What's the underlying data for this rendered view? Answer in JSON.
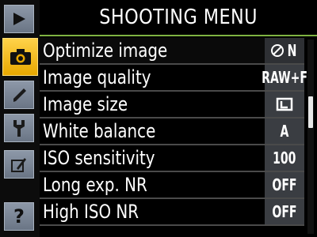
{
  "header": {
    "title": "SHOOTING MENU"
  },
  "tabs": [
    {
      "name": "playback-tab",
      "icon": "play-icon"
    },
    {
      "name": "shooting-tab",
      "icon": "camera-icon",
      "active": true
    },
    {
      "name": "custom-settings-tab",
      "icon": "pencil-icon"
    },
    {
      "name": "setup-tab",
      "icon": "wrench-icon"
    },
    {
      "name": "retouch-tab",
      "icon": "retouch-brush-icon"
    },
    {
      "name": "help-button",
      "icon": "help-icon",
      "glyph": "?"
    }
  ],
  "menu": {
    "items": [
      {
        "label": "Optimize image",
        "value": "N",
        "value_icon": "optimize-image-icon"
      },
      {
        "label": "Image quality",
        "value": "RAW+F"
      },
      {
        "label": "Image size",
        "value": "",
        "value_icon": "image-size-large-icon"
      },
      {
        "label": "White balance",
        "value": "A"
      },
      {
        "label": "ISO sensitivity",
        "value": "100"
      },
      {
        "label": "Long exp. NR",
        "value": "OFF"
      },
      {
        "label": "High ISO NR",
        "value": "OFF"
      }
    ]
  },
  "scrollbar": {
    "position_fraction": 0.35
  },
  "colors": {
    "accent": "#7fb342",
    "active_tab": "#f0b400",
    "value_bg": "#3a3d42"
  }
}
